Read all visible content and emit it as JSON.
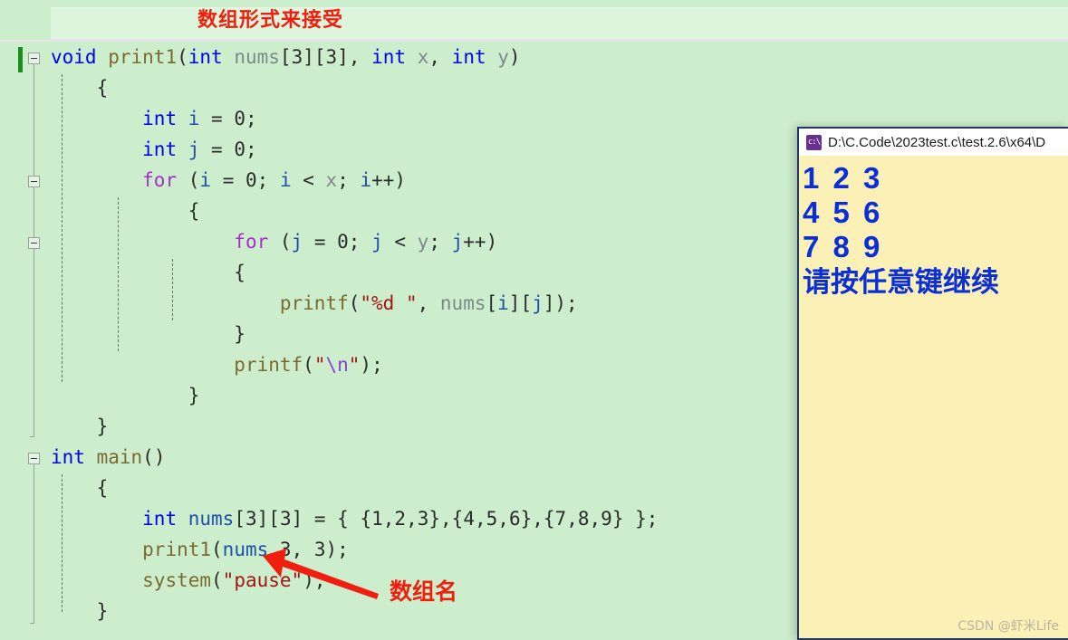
{
  "editor": {
    "background_color": "#cdeecd",
    "annotation_top": "数组形式来接受",
    "annotation_arrow_label": "数组名",
    "annotation_color": "#f01e0e",
    "code_lines": [
      {
        "indent": 0,
        "tokens": [
          {
            "t": "void",
            "c": "kw"
          },
          {
            "t": " ",
            "c": "pun"
          },
          {
            "t": "print1",
            "c": "fn"
          },
          {
            "t": "(",
            "c": "pun"
          },
          {
            "t": "int",
            "c": "kw"
          },
          {
            "t": " ",
            "c": "pun"
          },
          {
            "t": "nums",
            "c": "id"
          },
          {
            "t": "[",
            "c": "pun"
          },
          {
            "t": "3",
            "c": "num"
          },
          {
            "t": "][",
            "c": "pun"
          },
          {
            "t": "3",
            "c": "num"
          },
          {
            "t": "], ",
            "c": "pun"
          },
          {
            "t": "int",
            "c": "kw"
          },
          {
            "t": " ",
            "c": "pun"
          },
          {
            "t": "x",
            "c": "id"
          },
          {
            "t": ", ",
            "c": "pun"
          },
          {
            "t": "int",
            "c": "kw"
          },
          {
            "t": " ",
            "c": "pun"
          },
          {
            "t": "y",
            "c": "id"
          },
          {
            "t": ")",
            "c": "pun"
          }
        ]
      },
      {
        "indent": 1,
        "tokens": [
          {
            "t": "{",
            "c": "pun"
          }
        ]
      },
      {
        "indent": 2,
        "tokens": [
          {
            "t": "int",
            "c": "kw"
          },
          {
            "t": " ",
            "c": "pun"
          },
          {
            "t": "i",
            "c": "var"
          },
          {
            "t": " = ",
            "c": "pun"
          },
          {
            "t": "0",
            "c": "num"
          },
          {
            "t": ";",
            "c": "pun"
          }
        ]
      },
      {
        "indent": 2,
        "tokens": [
          {
            "t": "int",
            "c": "kw"
          },
          {
            "t": " ",
            "c": "pun"
          },
          {
            "t": "j",
            "c": "var"
          },
          {
            "t": " = ",
            "c": "pun"
          },
          {
            "t": "0",
            "c": "num"
          },
          {
            "t": ";",
            "c": "pun"
          }
        ]
      },
      {
        "indent": 2,
        "tokens": [
          {
            "t": "for",
            "c": "ctrl"
          },
          {
            "t": " (",
            "c": "pun"
          },
          {
            "t": "i",
            "c": "var"
          },
          {
            "t": " = ",
            "c": "pun"
          },
          {
            "t": "0",
            "c": "num"
          },
          {
            "t": "; ",
            "c": "pun"
          },
          {
            "t": "i",
            "c": "var"
          },
          {
            "t": " < ",
            "c": "pun"
          },
          {
            "t": "x",
            "c": "id"
          },
          {
            "t": "; ",
            "c": "pun"
          },
          {
            "t": "i",
            "c": "var"
          },
          {
            "t": "++)",
            "c": "pun"
          }
        ]
      },
      {
        "indent": 3,
        "tokens": [
          {
            "t": "{",
            "c": "pun"
          }
        ]
      },
      {
        "indent": 4,
        "tokens": [
          {
            "t": "for",
            "c": "ctrl"
          },
          {
            "t": " (",
            "c": "pun"
          },
          {
            "t": "j",
            "c": "var"
          },
          {
            "t": " = ",
            "c": "pun"
          },
          {
            "t": "0",
            "c": "num"
          },
          {
            "t": "; ",
            "c": "pun"
          },
          {
            "t": "j",
            "c": "var"
          },
          {
            "t": " < ",
            "c": "pun"
          },
          {
            "t": "y",
            "c": "id"
          },
          {
            "t": "; ",
            "c": "pun"
          },
          {
            "t": "j",
            "c": "var"
          },
          {
            "t": "++)",
            "c": "pun"
          }
        ]
      },
      {
        "indent": 4,
        "tokens": [
          {
            "t": "{",
            "c": "pun"
          }
        ]
      },
      {
        "indent": 5,
        "tokens": [
          {
            "t": "printf",
            "c": "fn"
          },
          {
            "t": "(",
            "c": "pun"
          },
          {
            "t": "\"%d \"",
            "c": "str"
          },
          {
            "t": ", ",
            "c": "pun"
          },
          {
            "t": "nums",
            "c": "id"
          },
          {
            "t": "[",
            "c": "pun"
          },
          {
            "t": "i",
            "c": "var"
          },
          {
            "t": "][",
            "c": "pun"
          },
          {
            "t": "j",
            "c": "var"
          },
          {
            "t": "]);",
            "c": "pun"
          }
        ]
      },
      {
        "indent": 4,
        "tokens": [
          {
            "t": "}",
            "c": "pun"
          }
        ]
      },
      {
        "indent": 4,
        "tokens": [
          {
            "t": "printf",
            "c": "fn"
          },
          {
            "t": "(",
            "c": "pun"
          },
          {
            "t": "\"",
            "c": "str"
          },
          {
            "t": "\\n",
            "c": "esc"
          },
          {
            "t": "\"",
            "c": "str"
          },
          {
            "t": ");",
            "c": "pun"
          }
        ]
      },
      {
        "indent": 3,
        "tokens": [
          {
            "t": "}",
            "c": "pun"
          }
        ]
      },
      {
        "indent": 1,
        "tokens": [
          {
            "t": "}",
            "c": "pun"
          }
        ]
      },
      {
        "indent": 0,
        "tokens": [
          {
            "t": "int",
            "c": "kw"
          },
          {
            "t": " ",
            "c": "pun"
          },
          {
            "t": "main",
            "c": "fn"
          },
          {
            "t": "()",
            "c": "pun"
          }
        ]
      },
      {
        "indent": 1,
        "tokens": [
          {
            "t": "{",
            "c": "pun"
          }
        ]
      },
      {
        "indent": 2,
        "tokens": [
          {
            "t": "int",
            "c": "kw"
          },
          {
            "t": " ",
            "c": "pun"
          },
          {
            "t": "nums",
            "c": "var"
          },
          {
            "t": "[",
            "c": "pun"
          },
          {
            "t": "3",
            "c": "num"
          },
          {
            "t": "][",
            "c": "pun"
          },
          {
            "t": "3",
            "c": "num"
          },
          {
            "t": "] = { {",
            "c": "pun"
          },
          {
            "t": "1",
            "c": "num"
          },
          {
            "t": ",",
            "c": "pun"
          },
          {
            "t": "2",
            "c": "num"
          },
          {
            "t": ",",
            "c": "pun"
          },
          {
            "t": "3",
            "c": "num"
          },
          {
            "t": "},{",
            "c": "pun"
          },
          {
            "t": "4",
            "c": "num"
          },
          {
            "t": ",",
            "c": "pun"
          },
          {
            "t": "5",
            "c": "num"
          },
          {
            "t": ",",
            "c": "pun"
          },
          {
            "t": "6",
            "c": "num"
          },
          {
            "t": "},{",
            "c": "pun"
          },
          {
            "t": "7",
            "c": "num"
          },
          {
            "t": ",",
            "c": "pun"
          },
          {
            "t": "8",
            "c": "num"
          },
          {
            "t": ",",
            "c": "pun"
          },
          {
            "t": "9",
            "c": "num"
          },
          {
            "t": "} };",
            "c": "pun"
          }
        ]
      },
      {
        "indent": 2,
        "tokens": [
          {
            "t": "print1",
            "c": "fn"
          },
          {
            "t": "(",
            "c": "pun"
          },
          {
            "t": "nums",
            "c": "var"
          },
          {
            "t": ",",
            "c": "pun"
          },
          {
            "t": "3",
            "c": "num"
          },
          {
            "t": ", ",
            "c": "pun"
          },
          {
            "t": "3",
            "c": "num"
          },
          {
            "t": ");",
            "c": "pun"
          }
        ]
      },
      {
        "indent": 2,
        "tokens": [
          {
            "t": "system",
            "c": "fn"
          },
          {
            "t": "(",
            "c": "pun"
          },
          {
            "t": "\"pause\"",
            "c": "str"
          },
          {
            "t": ");",
            "c": "pun"
          }
        ]
      },
      {
        "indent": 1,
        "tokens": [
          {
            "t": "}",
            "c": "pun"
          }
        ]
      }
    ]
  },
  "console": {
    "title": "D:\\C.Code\\2023test.c\\test.2.6\\x64\\D",
    "icon_text": "c:\\",
    "background_color": "#fbf0b6",
    "text_color": "#0b2fd6",
    "output_lines": [
      "1 2 3",
      "4 5 6",
      "7 8 9"
    ],
    "prompt": "请按任意键继续"
  },
  "watermark": "CSDN @虾米Life"
}
